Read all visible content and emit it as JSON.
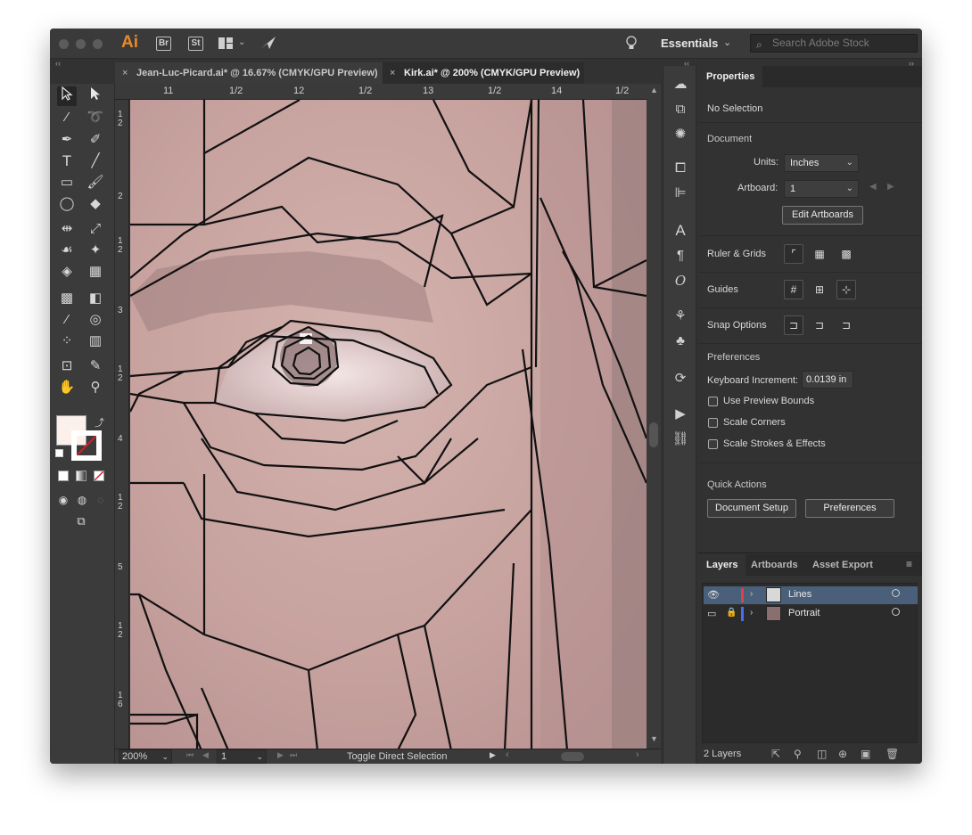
{
  "app": {
    "logo": "Ai",
    "bridge_label": "Br",
    "stock_label": "St",
    "workspace": "Essentials",
    "search_placeholder": "Search Adobe Stock"
  },
  "tabs": [
    {
      "label": "Jean-Luc-Picard.ai* @ 16.67% (CMYK/GPU Preview)",
      "close": "×"
    },
    {
      "label": "Kirk.ai* @ 200% (CMYK/GPU Preview)",
      "close": "×"
    }
  ],
  "ruler": {
    "h_ticks": [
      "11",
      "1/2",
      "12",
      "1/2",
      "13",
      "1/2",
      "14",
      "1/2"
    ],
    "v_ticks": [
      "1\n2",
      "2",
      "1\n2",
      "3",
      "1\n2",
      "4",
      "1\n2",
      "5",
      "1\n2",
      "1\n6"
    ]
  },
  "status": {
    "zoom": "200%",
    "artboard_number": "1",
    "tool_hint": "Toggle Direct Selection"
  },
  "properties": {
    "tab": "Properties",
    "selection": "No Selection",
    "document_heading": "Document",
    "units_label": "Units:",
    "units_value": "Inches",
    "artboard_label": "Artboard:",
    "artboard_value": "1",
    "edit_artboards": "Edit Artboards",
    "ruler_grids": "Ruler & Grids",
    "guides": "Guides",
    "snap_options": "Snap Options",
    "preferences_heading": "Preferences",
    "keyboard_increment_label": "Keyboard Increment:",
    "keyboard_increment_value": "0.0139 in",
    "use_preview_bounds": "Use Preview Bounds",
    "scale_corners": "Scale Corners",
    "scale_strokes": "Scale Strokes & Effects",
    "quick_actions": "Quick Actions",
    "document_setup": "Document Setup",
    "preferences_button": "Preferences"
  },
  "layers": {
    "tabs": [
      "Layers",
      "Artboards",
      "Asset Export"
    ],
    "rows": [
      {
        "name": "Lines",
        "color": "#e0404a"
      },
      {
        "name": "Portrait",
        "color": "#4a6cf0"
      }
    ],
    "count": "2 Layers"
  },
  "colors": {
    "accent_layer_selected": "#4a607a",
    "skin": "#c8a7a5"
  }
}
